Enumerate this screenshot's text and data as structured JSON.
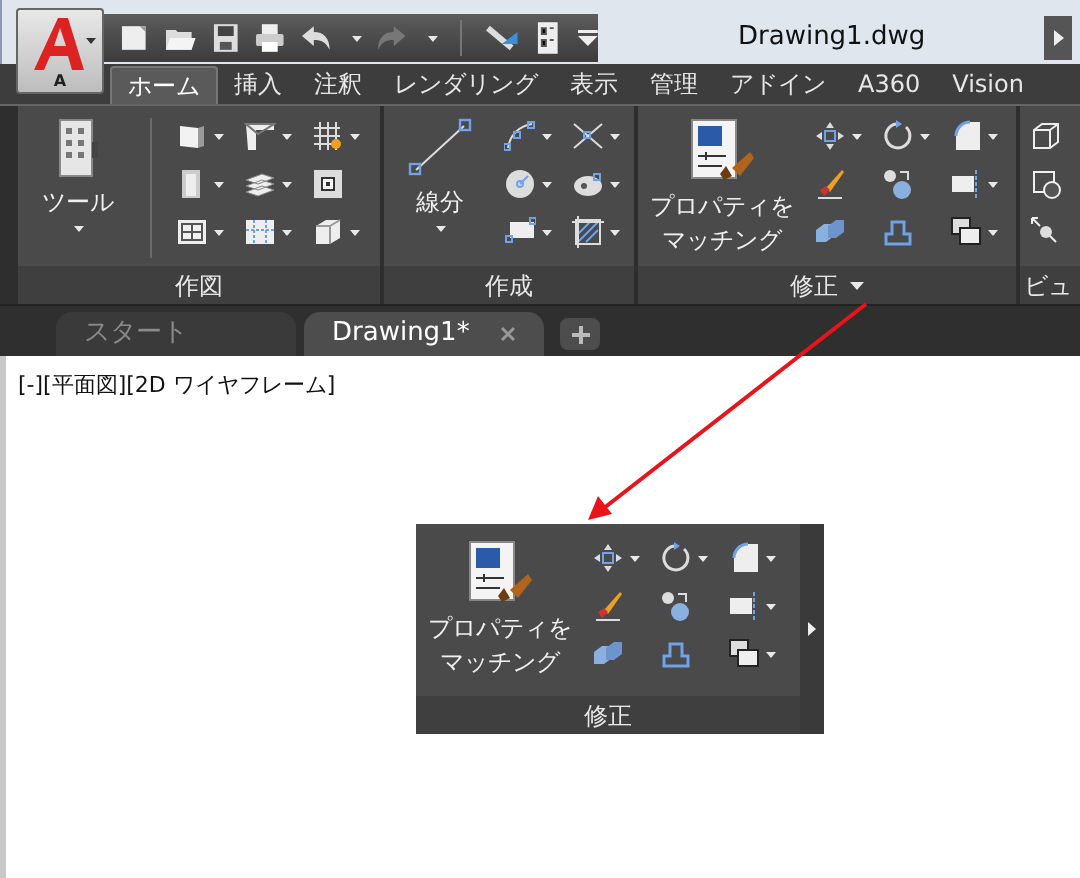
{
  "app_menu": {
    "label": "A"
  },
  "title": "Drawing1.dwg",
  "ribbon_tabs": [
    {
      "label": "ホーム",
      "selected": true
    },
    {
      "label": "挿入",
      "selected": false
    },
    {
      "label": "注釈",
      "selected": false
    },
    {
      "label": "レンダリング",
      "selected": false
    },
    {
      "label": "表示",
      "selected": false
    },
    {
      "label": "管理",
      "selected": false
    },
    {
      "label": "アドイン",
      "selected": false
    },
    {
      "label": "A360",
      "selected": false
    },
    {
      "label": "Vision",
      "selected": false
    }
  ],
  "panels": [
    {
      "title": "作図",
      "menu": false,
      "large": {
        "label": "ツール",
        "dropdown": true
      },
      "rows": [
        [
          {
            "dropdown": true
          },
          {
            "dropdown": true
          },
          {
            "dropdown": true
          }
        ],
        [
          {
            "dropdown": true
          },
          {
            "dropdown": true
          },
          {
            "dropdown": false
          }
        ],
        [
          {
            "dropdown": true
          },
          {
            "dropdown": true
          },
          {
            "dropdown": true
          }
        ]
      ]
    },
    {
      "title": "作成",
      "menu": false,
      "large": {
        "label": "線分",
        "dropdown": true
      },
      "rows": [
        [
          {
            "dropdown": true
          },
          {
            "dropdown": true
          }
        ],
        [
          {
            "dropdown": true
          },
          {
            "dropdown": true
          }
        ],
        [
          {
            "dropdown": true
          },
          {
            "dropdown": true
          }
        ]
      ]
    },
    {
      "title": "修正",
      "menu": true,
      "large": {
        "label": "プロパティをマッチング",
        "dropdown": false
      },
      "rows": [
        [
          {
            "dropdown": true
          },
          {
            "dropdown": true
          },
          {
            "dropdown": true
          }
        ],
        [
          {
            "dropdown": false
          },
          {
            "dropdown": false
          },
          {
            "dropdown": true
          }
        ],
        [
          {
            "dropdown": false
          },
          {
            "dropdown": false
          },
          {
            "dropdown": true
          }
        ]
      ]
    },
    {
      "title": "ビュ",
      "menu": false,
      "rows": [
        [
          {
            "dropdown": false
          }
        ],
        [
          {
            "dropdown": false
          }
        ],
        [
          {
            "dropdown": false
          }
        ]
      ]
    }
  ],
  "document_tabs": [
    {
      "label": "スタート",
      "selected": false
    },
    {
      "label": "Drawing1*",
      "selected": true
    }
  ],
  "viewport_label": "[-][平面図][2D ワイヤフレーム]",
  "callout": {
    "title": "修正",
    "large": {
      "label": "プロパティをマッチング",
      "dropdown": false
    },
    "rows": [
      [
        {
          "dropdown": true
        },
        {
          "dropdown": true
        },
        {
          "dropdown": true
        }
      ],
      [
        {
          "dropdown": false
        },
        {
          "dropdown": false
        },
        {
          "dropdown": true
        }
      ],
      [
        {
          "dropdown": false
        },
        {
          "dropdown": false
        },
        {
          "dropdown": true
        }
      ]
    ]
  }
}
